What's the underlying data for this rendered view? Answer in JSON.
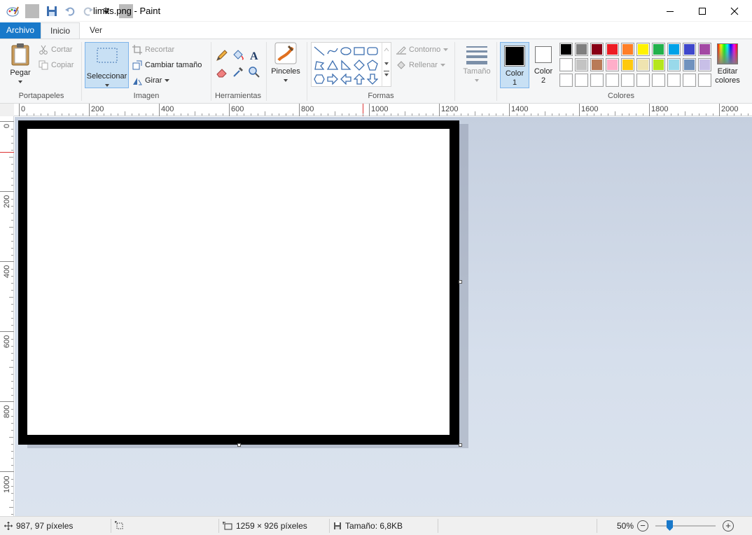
{
  "window": {
    "title": "limits.png - Paint"
  },
  "tabs": [
    {
      "label": "Archivo"
    },
    {
      "label": "Inicio"
    },
    {
      "label": "Ver"
    }
  ],
  "ribbon": {
    "portapapeles": {
      "group_label": "Portapapeles",
      "paste_label": "Pegar",
      "cut_label": "Cortar",
      "copy_label": "Copiar"
    },
    "imagen": {
      "group_label": "Imagen",
      "select_label": "Seleccionar",
      "crop_label": "Recortar",
      "resize_label": "Cambiar tamaño",
      "rotate_label": "Girar"
    },
    "herramientas": {
      "group_label": "Herramientas"
    },
    "pinceles": {
      "label": "Pinceles"
    },
    "formas": {
      "group_label": "Formas",
      "outline_label": "Contorno",
      "fill_label": "Rellenar"
    },
    "tamano": {
      "label": "Tamaño"
    },
    "colores": {
      "group_label": "Colores",
      "color1_label": "Color 1",
      "color1_line1": "Color",
      "color1_line2": "1",
      "color2_line1": "Color",
      "color2_line2": "2",
      "color1_value": "#000000",
      "color2_value": "#ffffff",
      "edit_line1": "Editar",
      "edit_line2": "colores",
      "palette_row1": [
        "#000000",
        "#7f7f7f",
        "#880015",
        "#ed1c24",
        "#ff7f27",
        "#fff200",
        "#22b14c",
        "#00a2e8",
        "#3f48cc",
        "#a349a4"
      ],
      "palette_row2": [
        "#ffffff",
        "#c3c3c3",
        "#b97a57",
        "#ffaec9",
        "#ffc90e",
        "#efe4b0",
        "#b5e61d",
        "#99d9ea",
        "#7092be",
        "#c8bfe7"
      ],
      "palette_row3_count": 10
    }
  },
  "ruler": {
    "h_labels": [
      "0",
      "200",
      "400",
      "600",
      "800",
      "1000",
      "1200",
      "1400",
      "1600",
      "1800",
      "2000"
    ],
    "v_labels": [
      "0",
      "200",
      "400",
      "600",
      "800",
      "1000"
    ]
  },
  "status": {
    "cursor_position": "987, 97 píxeles",
    "selection_size": "",
    "image_size": "1259 × 926 píxeles",
    "file_size": "Tamaño: 6,8KB",
    "zoom": "50%"
  }
}
